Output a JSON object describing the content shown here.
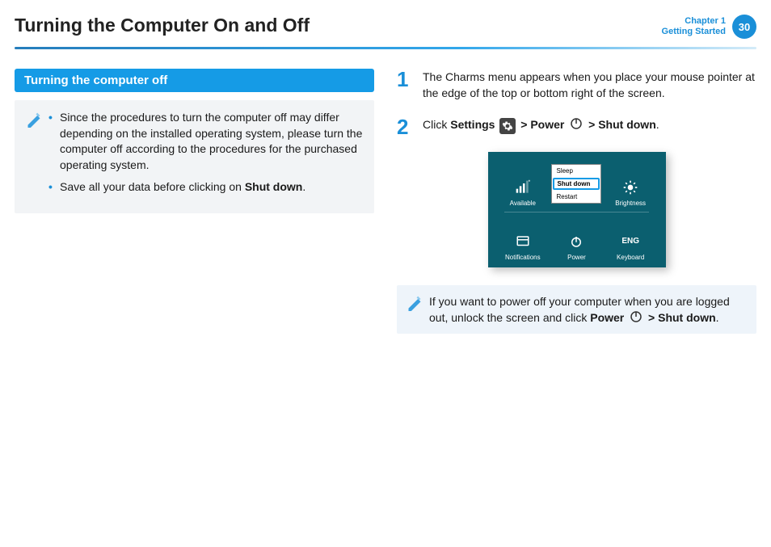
{
  "header": {
    "title": "Turning the Computer On and Off",
    "chapter_line1": "Chapter 1",
    "chapter_line2": "Getting Started",
    "page_number": "30"
  },
  "section": {
    "heading": "Turning the computer off"
  },
  "note": {
    "bullet1": "Since the procedures to turn the computer off may differ depending on the installed operating system, please turn the computer off according to the procedures for the purchased operating system.",
    "bullet2_pre": "Save all your data before clicking on ",
    "bullet2_bold": "Shut down",
    "bullet2_post": "."
  },
  "steps": {
    "s1_num": "1",
    "s1_text": "The Charms menu appears when you place your mouse pointer at the edge of the top or bottom right of the screen.",
    "s2_num": "2",
    "s2_pre": "Click ",
    "s2_settings": "Settings",
    "s2_gt1": " > ",
    "s2_power": "Power",
    "s2_gt2": " > ",
    "s2_shutdown": "Shut down",
    "s2_post": "."
  },
  "charms": {
    "available": "Available",
    "brightness": "Brightness",
    "notifications": "Notifications",
    "power": "Power",
    "keyboard": "Keyboard",
    "eng": "ENG",
    "menu_sleep": "Sleep",
    "menu_shutdown": "Shut down",
    "menu_restart": "Restart"
  },
  "tip": {
    "pre": "If you want to power off your computer when you are logged out, unlock the screen and click ",
    "power": "Power",
    "gt": " > ",
    "shutdown": "Shut down",
    "post": "."
  }
}
